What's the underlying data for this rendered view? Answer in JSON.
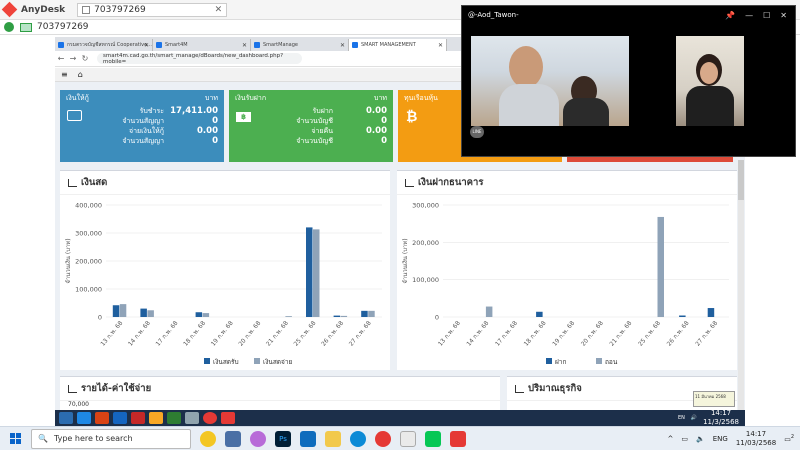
{
  "anydesk": {
    "app_name": "AnyDesk",
    "tab_label": "703797269",
    "address": "703797269"
  },
  "browser": {
    "tabs": [
      {
        "label": "กรมตรวจบัญชีสหกรณ์ Cooperative..."
      },
      {
        "label": "Smart4M"
      },
      {
        "label": "SmartManage"
      },
      {
        "label": "SMART MANAGEMENT"
      }
    ],
    "url": "smart4m.cad.go.th/smart_manage/dBoards/new_dashboard.php?mobile="
  },
  "cards": {
    "loan": {
      "title": "เงินให้กู้",
      "unit": "บาท",
      "rows": [
        {
          "label": "รับชำระ",
          "value": "17,411.00"
        },
        {
          "label": "จำนวนสัญญา",
          "value": "0"
        },
        {
          "label": "จ่ายเงินให้กู้",
          "value": "0.00"
        },
        {
          "label": "จำนวนสัญญา",
          "value": "0"
        }
      ]
    },
    "deposit": {
      "title": "เงินรับฝาก",
      "unit": "บาท",
      "rows": [
        {
          "label": "รับฝาก",
          "value": "0.00"
        },
        {
          "label": "จำนวนบัญชี",
          "value": "0"
        },
        {
          "label": "จ่ายคืน",
          "value": "0.00"
        },
        {
          "label": "จำนวนบัญชี",
          "value": "0"
        }
      ]
    },
    "shares": {
      "title": "ทุนเรือนหุ้น"
    }
  },
  "charts": {
    "cash": {
      "title": "เงินสด"
    },
    "bank": {
      "title": "เงินฝากธนาคาร"
    },
    "income": {
      "title": "รายได้-ค่าใช้จ่าย",
      "first_tick": "70,000"
    },
    "volume": {
      "title": "ปริมาณธุรกิจ"
    }
  },
  "chart_data": [
    {
      "type": "bar",
      "title": "เงินสด",
      "ylabel": "จำนวนเงิน (บาท)",
      "ylim": [
        0,
        400000
      ],
      "yticks": [
        "0",
        "100,000",
        "200,000",
        "300,000",
        "400,000"
      ],
      "categories": [
        "13 ก.พ. 68",
        "14 ก.พ. 68",
        "17 ก.พ. 68",
        "18 ก.พ. 68",
        "19 ก.พ. 68",
        "20 ก.พ. 68",
        "21 ก.พ. 68",
        "25 ก.พ. 68",
        "26 ก.พ. 68",
        "27 ก.พ. 68"
      ],
      "series": [
        {
          "name": "เงินสดรับ",
          "color": "#1f5f9e",
          "values": [
            42000,
            30000,
            0,
            17000,
            0,
            0,
            0,
            320000,
            5000,
            22000
          ]
        },
        {
          "name": "เงินสดจ่าย",
          "color": "#8fa3b8",
          "values": [
            46000,
            24000,
            0,
            14000,
            0,
            0,
            3000,
            313000,
            4000,
            22000
          ]
        }
      ],
      "legend": "bottom"
    },
    {
      "type": "bar",
      "title": "เงินฝากธนาคาร",
      "ylabel": "จำนวนเงิน (บาท)",
      "ylim": [
        0,
        300000
      ],
      "yticks": [
        "0",
        "100,000",
        "200,000",
        "300,000"
      ],
      "categories": [
        "13 ก.พ. 68",
        "14 ก.พ. 68",
        "17 ก.พ. 68",
        "18 ก.พ. 68",
        "19 ก.พ. 68",
        "20 ก.พ. 68",
        "21 ก.พ. 68",
        "25 ก.พ. 68",
        "26 ก.พ. 68",
        "27 ก.พ. 68"
      ],
      "series": [
        {
          "name": "ฝาก",
          "color": "#1f5f9e",
          "values": [
            0,
            0,
            0,
            14000,
            0,
            0,
            0,
            0,
            4000,
            24000
          ]
        },
        {
          "name": "ถอน",
          "color": "#8fa3b8",
          "values": [
            0,
            28000,
            0,
            0,
            0,
            0,
            0,
            268000,
            0,
            0
          ]
        }
      ],
      "legend": "bottom"
    }
  ],
  "video_call": {
    "title": "@-Aod_Tawon-",
    "logo": "LINE"
  },
  "remote_taskbar": {
    "lang": "EN",
    "time": "14:17",
    "date": "11/3/2568",
    "tooltip": "11 มีนาคม 2568"
  },
  "taskbar": {
    "search_placeholder": "Type here to search",
    "lang": "ENG",
    "time": "14:17",
    "date": "11/03/2568",
    "notif_count": "2"
  },
  "colors": {
    "card_blue": "#3c8dbc",
    "card_green": "#4caf50",
    "card_orange": "#f39c12",
    "card_red": "#dd4b39"
  }
}
